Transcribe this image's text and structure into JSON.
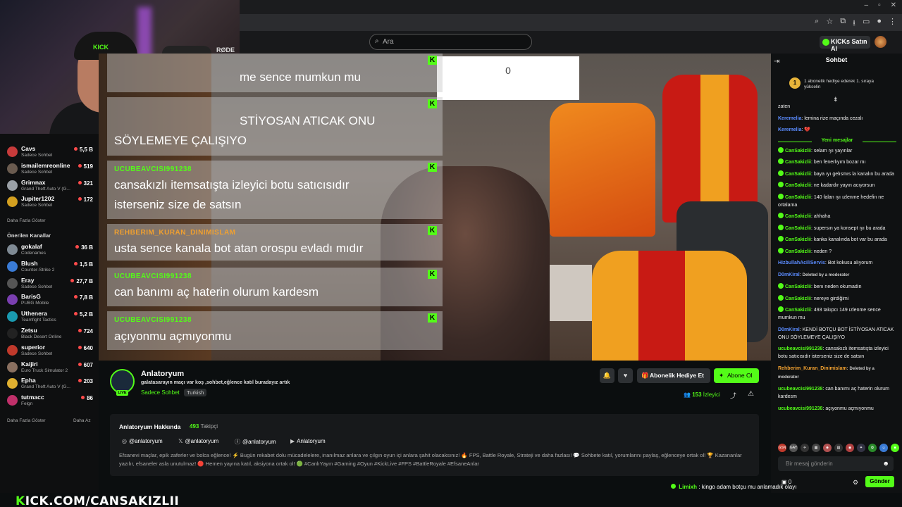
{
  "search": {
    "placeholder": "Ara"
  },
  "topbar": {
    "buy_kicks": "KICKs Satın Al"
  },
  "webcam": {
    "mic_brand": "RØDE",
    "cap_brand": "KICK"
  },
  "sidebar": {
    "channels": [
      {
        "name": "Cavs",
        "category": "Sadece Sohbet",
        "viewers": "5,5 B",
        "color": "#c73b3b"
      },
      {
        "name": "ismailemreonline",
        "category": "Sadece Sohbet",
        "viewers": "519",
        "color": "#6a5b4f"
      },
      {
        "name": "Grimnax",
        "category": "Grand Theft Auto V (G...",
        "viewers": "321",
        "color": "#9aa0a6"
      },
      {
        "name": "Jupiter1202",
        "category": "Sadece Sohbet",
        "viewers": "172",
        "color": "#d4a020"
      }
    ],
    "show_more": "Daha Fazla Göster",
    "recommended_header": "Önerilen Kanallar",
    "recommended": [
      {
        "name": "gokalaf",
        "category": "Codenames",
        "viewers": "36 B",
        "color": "#7f8a94"
      },
      {
        "name": "Blush",
        "category": "Counter-Strike 2",
        "viewers": "1,5 B",
        "color": "#3a7bd5"
      },
      {
        "name": "Eray",
        "category": "Sadece Sohbet",
        "viewers": "27,7 B",
        "color": "#555"
      },
      {
        "name": "BarisG",
        "category": "PUBG Mobile",
        "viewers": "7,8 B",
        "color": "#7a3fb0"
      },
      {
        "name": "Uthenera",
        "category": "Teamfight Tactics",
        "viewers": "5,2 B",
        "color": "#1a9ab0"
      },
      {
        "name": "Zetsu",
        "category": "Black Desert Online",
        "viewers": "724",
        "color": "#222"
      },
      {
        "name": "superior",
        "category": "Sadece Sohbet",
        "viewers": "640",
        "color": "#c0392b"
      },
      {
        "name": "Kaijiri",
        "category": "Euro Truck Simulator 2",
        "viewers": "607",
        "color": "#8a7060"
      },
      {
        "name": "Epha",
        "category": "Grand Theft Auto V (G...",
        "viewers": "203",
        "color": "#e0b030"
      },
      {
        "name": "tutmacc",
        "category": "Felgn",
        "viewers": "86",
        "color": "#c0306a"
      }
    ],
    "show_more_bottom": "Daha Fazla Göster",
    "show_less": "Daha Az"
  },
  "video": {
    "score": "0",
    "overlay": [
      {
        "user": "",
        "text": "me sence mumkun mu"
      },
      {
        "user": "",
        "text": "STİYOSAN ATICAK ONU"
      },
      {
        "user": "",
        "text": "SÖYLEMEYE ÇALIŞIYO"
      },
      {
        "user": "UCUBEAVCISI991238",
        "text": "cansakızlı itemsatışta izleyici botu satıcısıdır"
      },
      {
        "user": "",
        "text": "isterseniz size de satsın"
      },
      {
        "user": "REHBERIM_KURAN_DINIMISLAM",
        "text": "usta sence kanala bot atan orospu evladı mıdır"
      },
      {
        "user": "UCUBEAVCISI991238",
        "text": "can banımı aç haterin olurum kardesm"
      },
      {
        "user": "UCUBEAVCISI991238",
        "text": "açıyonmu açmıyonmu"
      }
    ]
  },
  "stream": {
    "channel": "Anlatoryum",
    "title": "galatasarayın maçı var koş ,sohbet,eğlence katıl buradayız artık",
    "category": "Sadece Sohbet",
    "tag": "Turkish",
    "live": "LIVE",
    "gift_sub": "Abonelik Hediye Et",
    "subscribe": "Abone Ol",
    "viewers": "153",
    "viewers_label": "İzleyici"
  },
  "about": {
    "header": "Anlatoryum Hakkında",
    "followers": "493",
    "followers_label": "Takipçi",
    "socials": [
      "@anlatoryum",
      "@anlatoryum",
      "@anlatoryum",
      "Anlatoryum"
    ],
    "description": "Efsanevi maçlar, epik zaferler ve bolca eğlence! ⚡ Bugün rekabet dolu mücadelelere, inanılmaz anlara ve çılgın oyun içi anlara şahit olacaksınız! 🔥 FPS, Battle Royale, Strateji ve daha fazlası! 💬 Sohbete katıl, yorumlarını paylaş, eğlenceye ortak ol! 🏆 Kazananlar yazılır, efsaneler asla unutulmaz! 🔴 Hemen yayına katıl, aksiyona ortak ol! 🟢 #CanlıYayın #Gaming #Oyun #KickLive #FPS #BattleRoyale #EfsaneAnlar"
  },
  "chat": {
    "header": "Sohbet",
    "gift_banner": "1 abonelik hediye ederek 1. sıraya yükselin",
    "gift_rank": "1",
    "pre_messages": [
      {
        "user": "",
        "text": "zaten",
        "color": "#fff"
      },
      {
        "user": "Keremelia",
        "text": "lemina rize maçında cezalı",
        "color": "#5b8cff"
      },
      {
        "user": "Keremelia",
        "text": "💔",
        "color": "#5b8cff"
      }
    ],
    "new_messages_label": "Yeni mesajlar",
    "messages": [
      {
        "user": "CanSakizlii",
        "text": "selam ıyı yayınlar",
        "color": "#53fc18",
        "badge": true
      },
      {
        "user": "CanSakizlii",
        "text": "ben fenerlıyım bozar mı",
        "color": "#53fc18",
        "badge": true
      },
      {
        "user": "CanSakizlii",
        "text": "baya ıyı gelısmıs la kanalın bu arada",
        "color": "#53fc18",
        "badge": true
      },
      {
        "user": "CanSakizlii",
        "text": "ne kadardır yayın acıyorsun",
        "color": "#53fc18",
        "badge": true
      },
      {
        "user": "CanSakizlii",
        "text": "140 falan ıyı ızlenme hedefin ne ortalama",
        "color": "#53fc18",
        "badge": true
      },
      {
        "user": "CanSakizlii",
        "text": "ahhaha",
        "color": "#53fc18",
        "badge": true
      },
      {
        "user": "CanSakizlii",
        "text": "supersın ya konsept ıyı bu arada",
        "color": "#53fc18",
        "badge": true
      },
      {
        "user": "CanSakizlii",
        "text": "kanka kanalında bot var bu arada",
        "color": "#53fc18",
        "badge": true
      },
      {
        "user": "CanSakizlii",
        "text": "neden ?",
        "color": "#53fc18",
        "badge": true
      },
      {
        "user": "HizbullahAciliServis",
        "text": "Bot kokusu alıyorum",
        "color": "#5b8cff",
        "badge": false
      },
      {
        "user": "D0mKiral",
        "text": "Deleted by a moderator",
        "color": "#5b8cff",
        "badge": false,
        "deleted": true
      },
      {
        "user": "CanSakizlii",
        "text": "benı neden okumadın",
        "color": "#53fc18",
        "badge": true
      },
      {
        "user": "CanSakizlii",
        "text": "nereye girdiğimi",
        "color": "#53fc18",
        "badge": true
      },
      {
        "user": "CanSakizlii",
        "text": "493 takıpcı 149 ızlenme sence mumkun mu",
        "color": "#53fc18",
        "badge": true
      },
      {
        "user": "D0mKiral",
        "text": "KENDİ BOTÇU BOT İSTİYOSAN ATICAK ONU SÖYLEMEYE ÇALIŞIYO",
        "color": "#5b8cff",
        "badge": false
      },
      {
        "user": "ucubeavcisi991238",
        "text": "cansakızlı itemsatışta izleyici botu satıcısıdır isterseniz size de satsın",
        "color": "#53fc18",
        "badge": false
      },
      {
        "user": "Rehberim_Kuran_Dinimislam",
        "text": "Deleted by a moderator",
        "color": "#f0a030",
        "badge": false,
        "deleted": true
      },
      {
        "user": "ucubeavcisi991238",
        "text": "can banımı aç haterin olurum kardesm",
        "color": "#53fc18",
        "badge": false
      },
      {
        "user": "ucubeavcisi991238",
        "text": "açıyonmu açmıyonmu",
        "color": "#53fc18",
        "badge": false
      }
    ],
    "emotes": [
      {
        "label": "GSN",
        "color": "#c0392b"
      },
      {
        "label": "GAY",
        "color": "#555"
      },
      {
        "label": "✈",
        "color": "#333"
      },
      {
        "label": "▦",
        "color": "#444"
      },
      {
        "label": "☻",
        "color": "#b05050"
      },
      {
        "label": "▤",
        "color": "#333"
      },
      {
        "label": "◉",
        "color": "#b04040"
      },
      {
        "label": "✦",
        "color": "#334"
      },
      {
        "label": "✿",
        "color": "#2a8a2a"
      },
      {
        "label": "☺",
        "color": "#3a7bd5"
      },
      {
        "label": "■",
        "color": "#53fc18"
      },
      {
        "label": "●",
        "color": "#2a8a2a"
      }
    ],
    "input_placeholder": "Bir mesaj gönderin",
    "kicks": "0",
    "send": "Gönder"
  },
  "ticker": {
    "user": "Limixh",
    "text": "kingo adam botçu mu anlamadık olayı"
  },
  "watermark": {
    "prefix": "K",
    "text": "ICK.COM/CANSAKIZLII"
  }
}
